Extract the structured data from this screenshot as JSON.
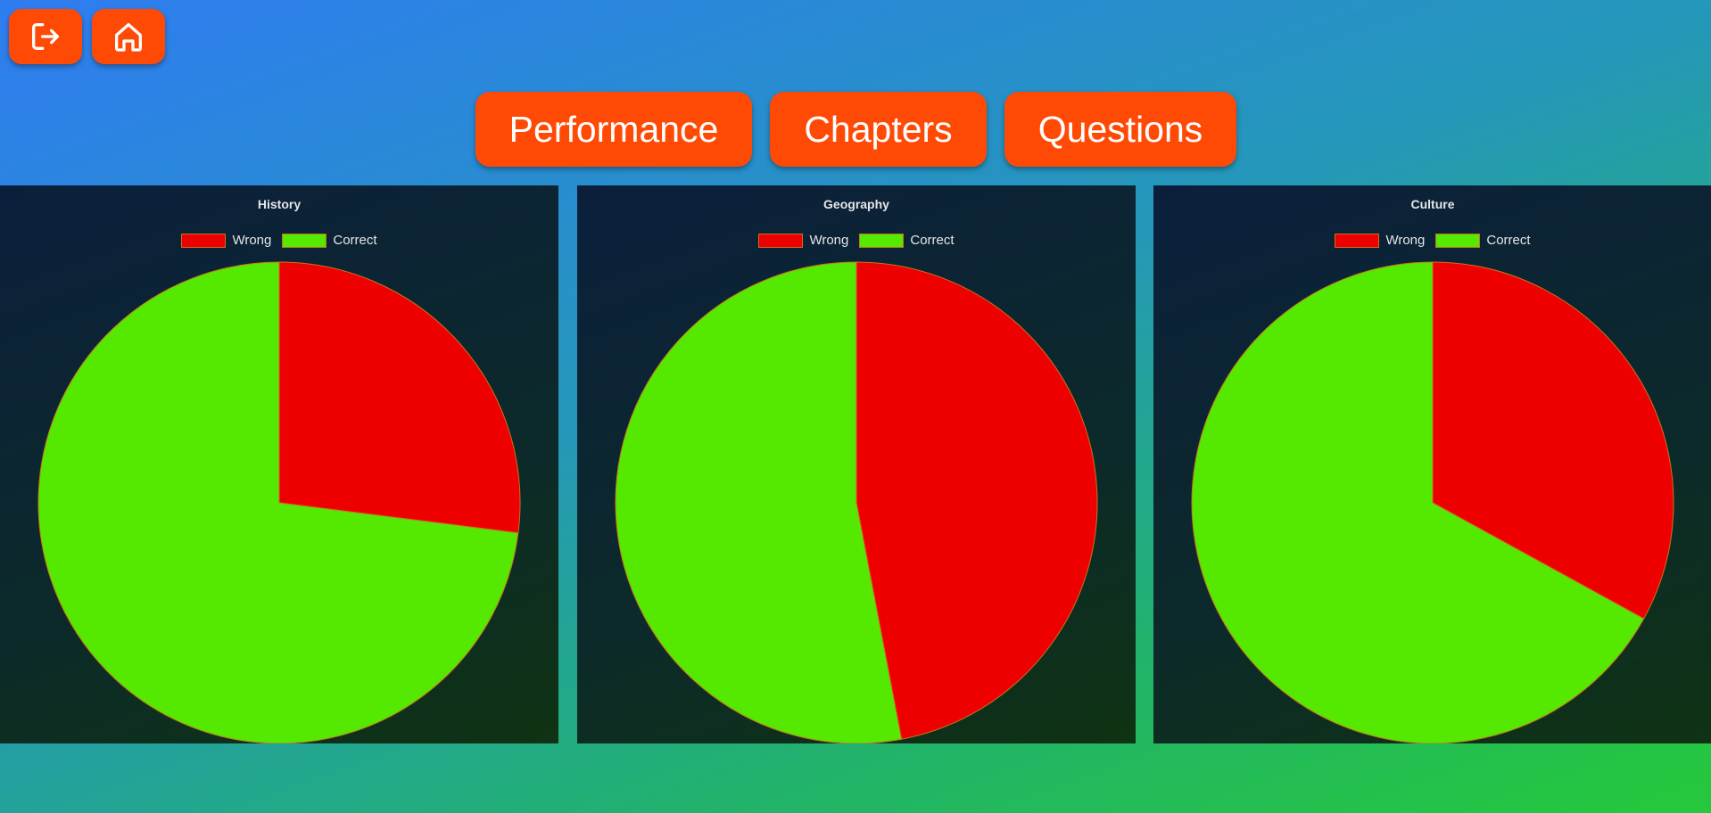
{
  "top_buttons": [
    {
      "name": "logout-button",
      "icon": "logout-icon"
    },
    {
      "name": "home-button",
      "icon": "home-icon"
    }
  ],
  "nav": {
    "performance_label": "Performance",
    "chapters_label": "Chapters",
    "questions_label": "Questions"
  },
  "colors": {
    "accent": "#ff4a05",
    "wrong": "#ee0000",
    "correct": "#55e800",
    "slice_border": "#c9731f"
  },
  "chart_data": [
    {
      "type": "pie",
      "title": "History",
      "legend": [
        "Wrong",
        "Correct"
      ],
      "legend_placement": "top",
      "values": [
        27,
        73
      ]
    },
    {
      "type": "pie",
      "title": "Geography",
      "legend": [
        "Wrong",
        "Correct"
      ],
      "legend_placement": "top",
      "values": [
        47,
        53
      ]
    },
    {
      "type": "pie",
      "title": "Culture",
      "legend": [
        "Wrong",
        "Correct"
      ],
      "legend_placement": "top",
      "values": [
        33,
        67
      ]
    }
  ]
}
